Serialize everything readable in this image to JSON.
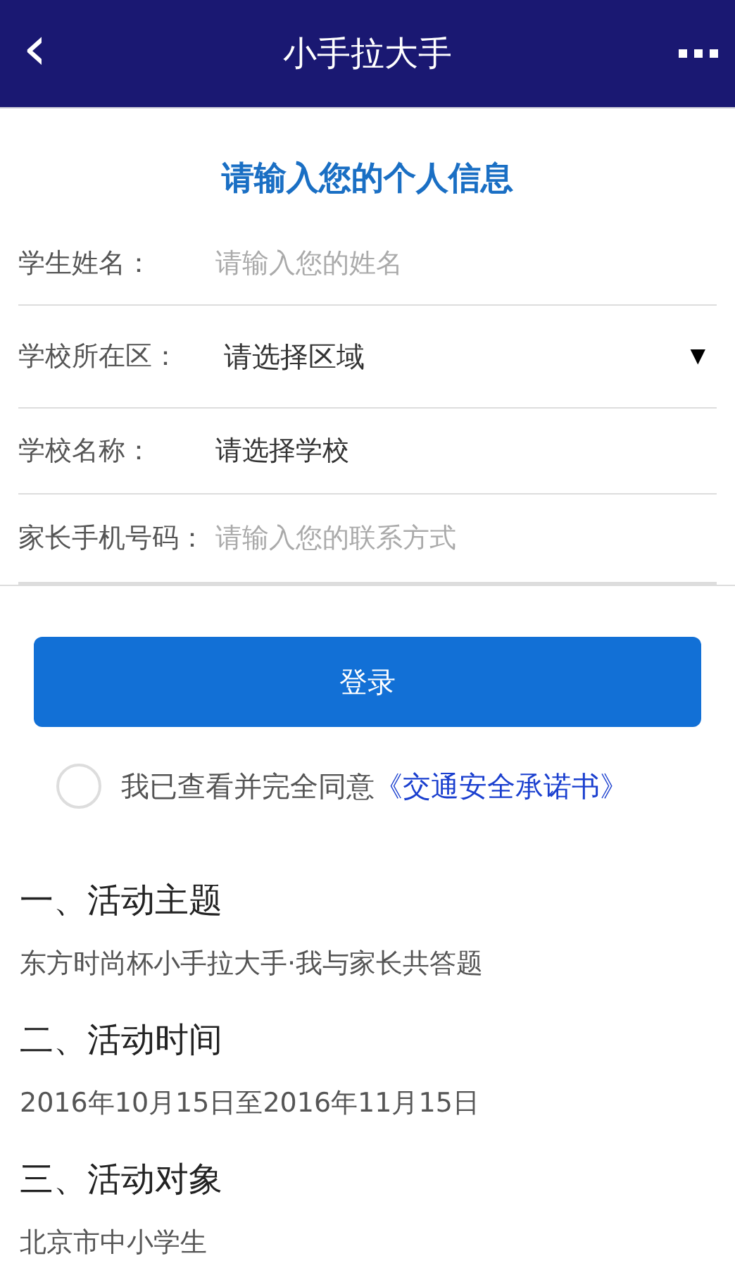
{
  "header": {
    "back_icon": "‹",
    "title": "小手拉大手"
  },
  "form": {
    "title": "请输入您的个人信息",
    "fields": [
      {
        "kind": "input",
        "label": "学生姓名：",
        "placeholder": "请输入您的姓名"
      },
      {
        "kind": "select",
        "label": "学校所在区：",
        "value": "请选择区域",
        "caret": "▼"
      },
      {
        "kind": "picker",
        "label": "学校名称：",
        "value": "请选择学校"
      },
      {
        "kind": "input",
        "label": "家长手机号码：",
        "placeholder": "请输入您的联系方式"
      }
    ],
    "submit": "登录"
  },
  "agreement": {
    "checked": false,
    "text": "我已查看并完全同意",
    "link": "《交通安全承诺书》"
  },
  "sections": [
    {
      "heading": "一、活动主题",
      "body": "东方时尚杯小手拉大手·我与家长共答题"
    },
    {
      "heading": "二、活动时间",
      "body": "2016年10月15日至2016年11月15日"
    },
    {
      "heading": "三、活动对象",
      "body": "北京市中小学生"
    }
  ]
}
